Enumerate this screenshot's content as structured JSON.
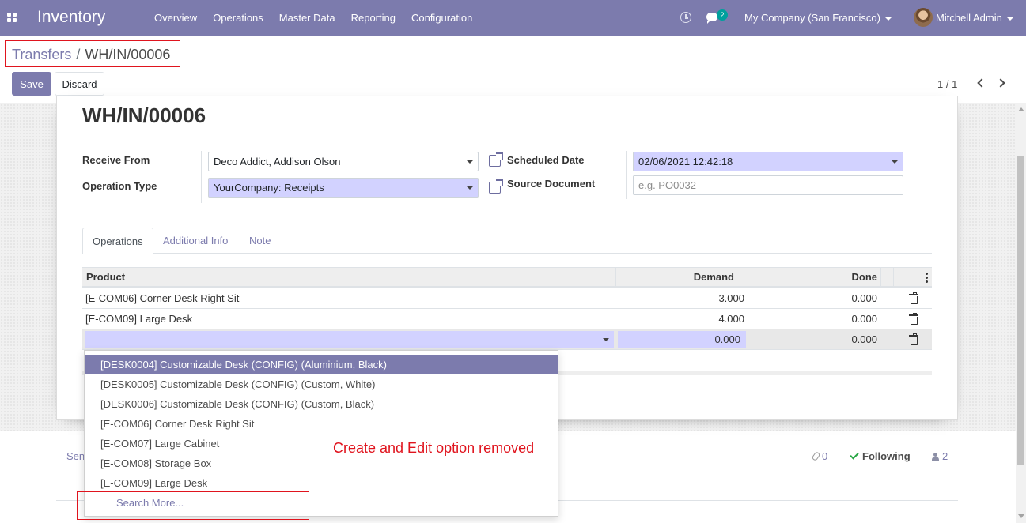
{
  "navbar": {
    "app_name": "Inventory",
    "menu": [
      "Overview",
      "Operations",
      "Master Data",
      "Reporting",
      "Configuration"
    ],
    "chat_count": "2",
    "company": "My Company (San Francisco)",
    "user": "Mitchell Admin"
  },
  "breadcrumb": {
    "parent": "Transfers",
    "separator": "/",
    "current": "WH/IN/00006"
  },
  "buttons": {
    "save": "Save",
    "discard": "Discard"
  },
  "pager": {
    "value": "1 / 1"
  },
  "record": {
    "title": "WH/IN/00006",
    "fields": {
      "receive_from_label": "Receive From",
      "receive_from_value": "Deco Addict, Addison Olson",
      "operation_type_label": "Operation Type",
      "operation_type_value": "YourCompany: Receipts",
      "scheduled_date_label": "Scheduled Date",
      "scheduled_date_value": "02/06/2021 12:42:18",
      "source_document_label": "Source Document",
      "source_document_placeholder": "e.g. PO0032"
    }
  },
  "tabs": [
    "Operations",
    "Additional Info",
    "Note"
  ],
  "table": {
    "headers": {
      "product": "Product",
      "demand": "Demand",
      "done": "Done"
    },
    "rows": [
      {
        "product": "[E-COM06] Corner Desk Right Sit",
        "demand": "3.000",
        "done": "0.000"
      },
      {
        "product": "[E-COM09] Large Desk",
        "demand": "4.000",
        "done": "0.000"
      }
    ],
    "edit_row": {
      "demand": "0.000",
      "done": "0.000"
    }
  },
  "dropdown": {
    "items": [
      "[DESK0004] Customizable Desk (CONFIG) (Aluminium, Black)",
      "[DESK0005] Customizable Desk (CONFIG) (Custom, White)",
      "[DESK0006] Customizable Desk (CONFIG) (Custom, Black)",
      "[E-COM06] Corner Desk Right Sit",
      "[E-COM07] Large Cabinet",
      "[E-COM08] Storage Box",
      "[E-COM09] Large Desk"
    ],
    "search_more": "Search More..."
  },
  "chatter": {
    "send": "Sen",
    "attachments": "0",
    "following": "Following",
    "followers": "2"
  },
  "annotation": {
    "text": "Create and Edit option removed",
    "color": "#e0141e"
  },
  "colors": {
    "brand": "#7c7bad",
    "required_field": "#d2d2ff",
    "annotation": "#e0141e"
  }
}
